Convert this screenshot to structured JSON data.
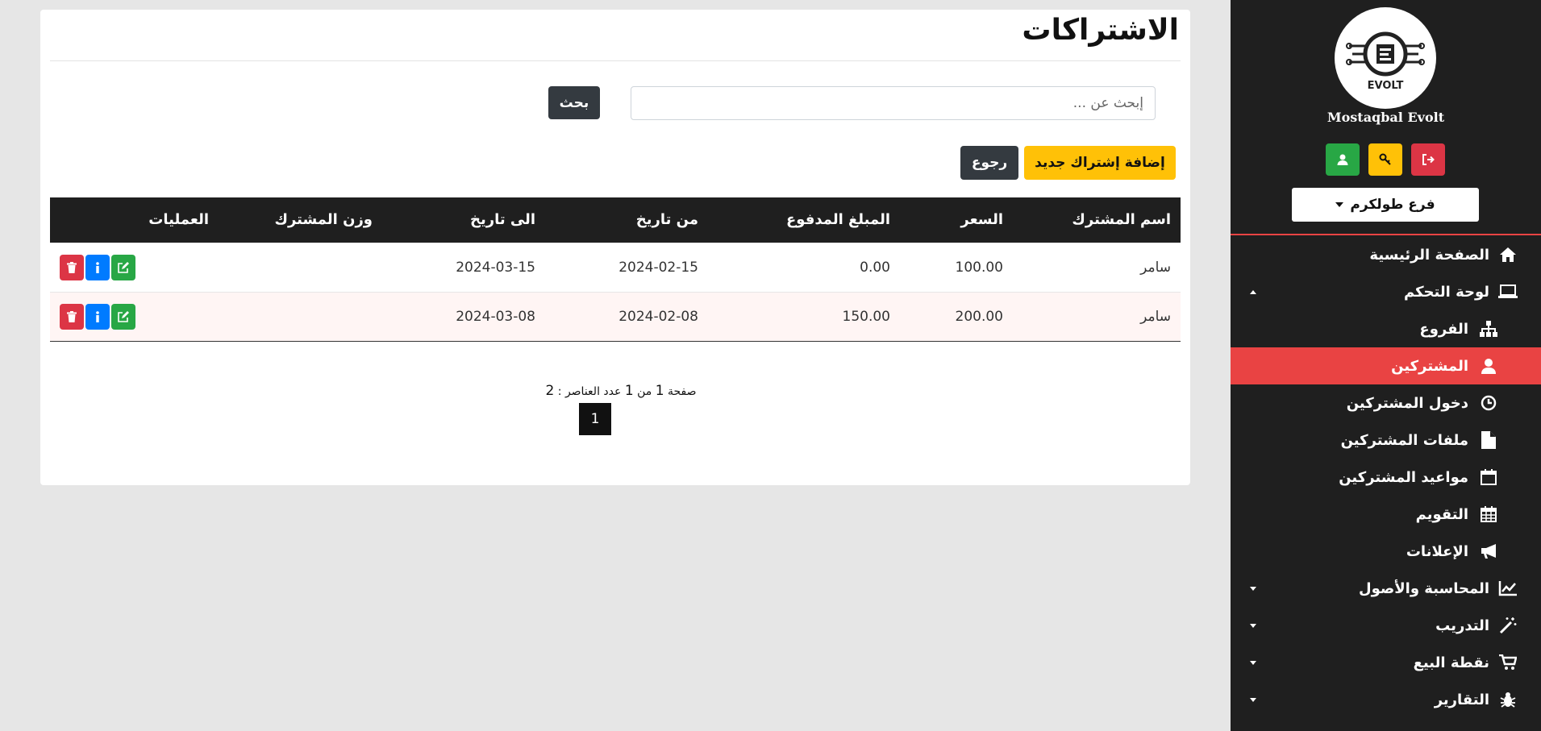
{
  "sidebar": {
    "brand": "Mostaqbal Evolt",
    "logo_text": "EVOLT",
    "branch": "فرع طولكرم",
    "nav": [
      {
        "label": "الصفحة الرئيسية",
        "icon": "home-icon"
      },
      {
        "label": "لوحة التحكم",
        "icon": "laptop-icon"
      },
      {
        "label": "الفروع",
        "icon": "sitemap-icon"
      },
      {
        "label": "المشتركين",
        "icon": "user-icon"
      },
      {
        "label": "دخول المشتركين",
        "icon": "clock-icon"
      },
      {
        "label": "ملفات المشتركين",
        "icon": "file-icon"
      },
      {
        "label": "مواعيد المشتركين",
        "icon": "calendar-icon"
      },
      {
        "label": "التقويم",
        "icon": "calendar-grid-icon"
      },
      {
        "label": "الإعلانات",
        "icon": "megaphone-icon"
      },
      {
        "label": "المحاسبة والأصول",
        "icon": "chart-line-icon"
      },
      {
        "label": "التدريب",
        "icon": "magic-wand-icon"
      },
      {
        "label": "نقطة البيع",
        "icon": "cart-icon"
      },
      {
        "label": "التقارير",
        "icon": "bug-icon"
      }
    ]
  },
  "main": {
    "title": "الاشتراكات",
    "search_placeholder": "إبحث عن ...",
    "search_button": "بحث",
    "add_button": "إضافة إشتراك جديد",
    "back_button": "رجوع",
    "columns": [
      "اسم المشترك",
      "السعر",
      "المبلغ المدفوع",
      "من تاريخ",
      "الى تاريخ",
      "وزن المشترك",
      "العمليات"
    ],
    "rows": [
      [
        "سامر",
        "100.00",
        "0.00",
        "2024-02-15",
        "2024-03-15",
        ""
      ],
      [
        "سامر",
        "200.00",
        "150.00",
        "2024-02-08",
        "2024-03-08",
        ""
      ]
    ],
    "pager": {
      "page_word": "صفحة",
      "current": "1",
      "of_word": "من",
      "total": "1",
      "count_label": "عدد العناصر :",
      "count": "2",
      "page_button": "1"
    }
  },
  "colors": {
    "sidebar_bg": "#1f1f1f",
    "active_item": "#e94343",
    "add_button": "#ffc107",
    "dark_button": "#343a40",
    "edit": "#28a745",
    "info": "#007bff",
    "delete": "#dc3545"
  }
}
